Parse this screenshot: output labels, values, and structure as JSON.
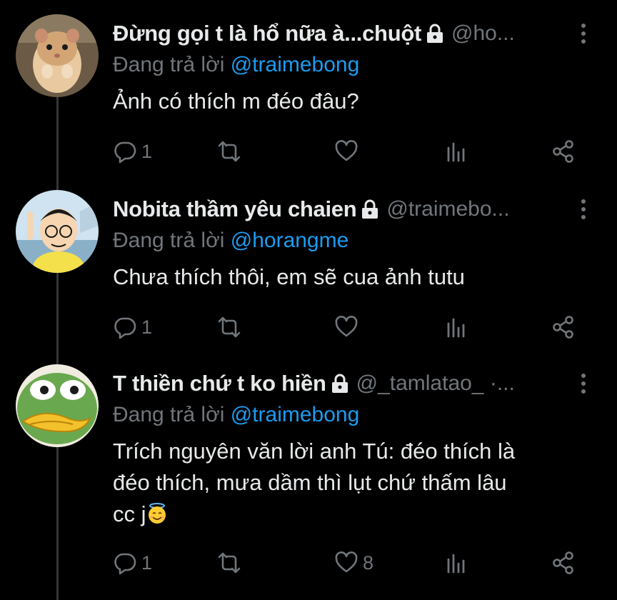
{
  "colors": {
    "background": "#000000",
    "text": "#e7e9ea",
    "muted": "#71767b",
    "mention": "#1d9bf0",
    "thread_line": "#333639"
  },
  "tweets": [
    {
      "display_name": "Đừng gọi t là hổ nữa à...chuột",
      "handle": "@ho...",
      "reply_label": "Đang trả lời",
      "reply_mention": "@traimebong",
      "text": "Ảnh có thích m đéo đâu?",
      "reply_count": "1",
      "like_count": "",
      "avatar": "hamster-avatar",
      "protected": true
    },
    {
      "display_name": "Nobita thầm yêu chaien",
      "handle": "@traimebo...",
      "reply_label": "Đang trả lời",
      "reply_mention": "@horangme",
      "text": "Chưa thích thôi, em sẽ cua ảnh tutu",
      "reply_count": "1",
      "like_count": "",
      "avatar": "nobita-avatar",
      "protected": true
    },
    {
      "display_name": "T thiền chứ t ko hiền",
      "handle": "@_tamlatao_ ·...",
      "reply_label": "Đang trả lời",
      "reply_mention": "@traimebong",
      "text_line1": "Trích nguyên văn lời anh Tú: đéo thích là",
      "text_line2": "đéo thích, mưa dầm thì lụt chứ thấm lâu",
      "text_line3": "cc j",
      "emoji": "smiling-face-with-halo",
      "reply_count": "1",
      "like_count": "8",
      "avatar": "frog-avatar",
      "protected": true
    }
  ]
}
